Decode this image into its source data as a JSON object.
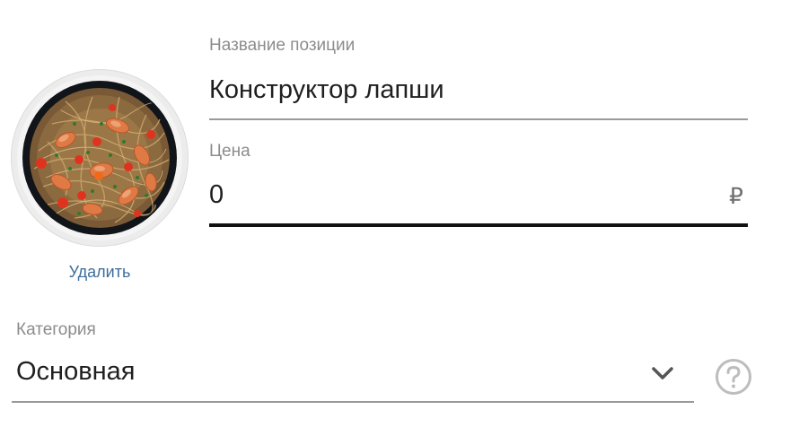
{
  "item": {
    "delete_label": "Удалить",
    "name_label": "Название позиции",
    "name_value": "Конструктор лапши",
    "price_label": "Цена",
    "price_value": "0",
    "currency_symbol": "₽",
    "category_label": "Категория",
    "category_value": "Основная"
  },
  "icons": {
    "dropdown": "chevron-down-icon",
    "help": "question-circle-icon"
  },
  "colors": {
    "link": "#3d6e9a",
    "label": "#8c8c8c",
    "text": "#1f1f1f",
    "active_underline": "#111111",
    "underline": "#9a9a9a",
    "icon": "#bdbdbd"
  }
}
